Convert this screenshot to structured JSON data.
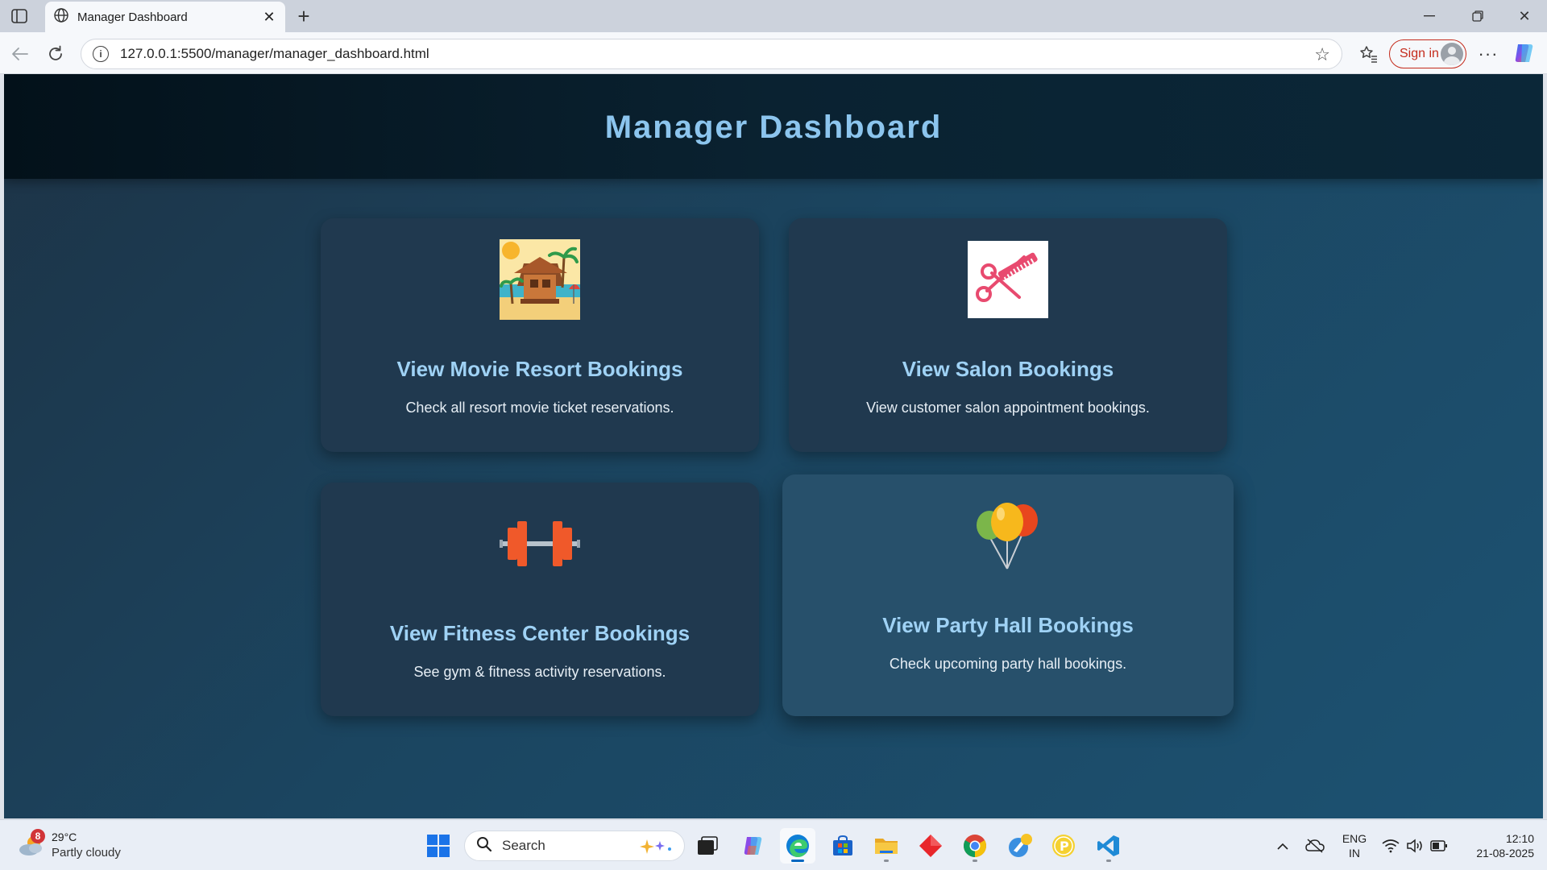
{
  "browser": {
    "tab_title": "Manager Dashboard",
    "url": "127.0.0.1:5500/manager/manager_dashboard.html",
    "signin_label": "Sign in"
  },
  "page": {
    "title": "Manager Dashboard",
    "cards": [
      {
        "title": "View Movie Resort Bookings",
        "description": "Check all resort movie ticket reservations.",
        "icon": "beach-resort-icon"
      },
      {
        "title": "View Salon Bookings",
        "description": "View customer salon appointment bookings.",
        "icon": "scissors-comb-icon"
      },
      {
        "title": "View Fitness Center Bookings",
        "description": "See gym & fitness activity reservations.",
        "icon": "dumbbell-icon"
      },
      {
        "title": "View Party Hall Bookings",
        "description": "Check upcoming party hall bookings.",
        "icon": "balloons-icon"
      }
    ]
  },
  "taskbar": {
    "weather_badge": "8",
    "weather_temp": "29°C",
    "weather_desc": "Partly cloudy",
    "search_label": "Search",
    "lang_line1": "ENG",
    "lang_line2": "IN",
    "time": "12:10",
    "date": "21-08-2025"
  },
  "colors": {
    "title": "#8cc5ee",
    "card_bg": "#20394f",
    "card_title": "#9fd2f5",
    "signin_accent": "#c42b1c"
  }
}
